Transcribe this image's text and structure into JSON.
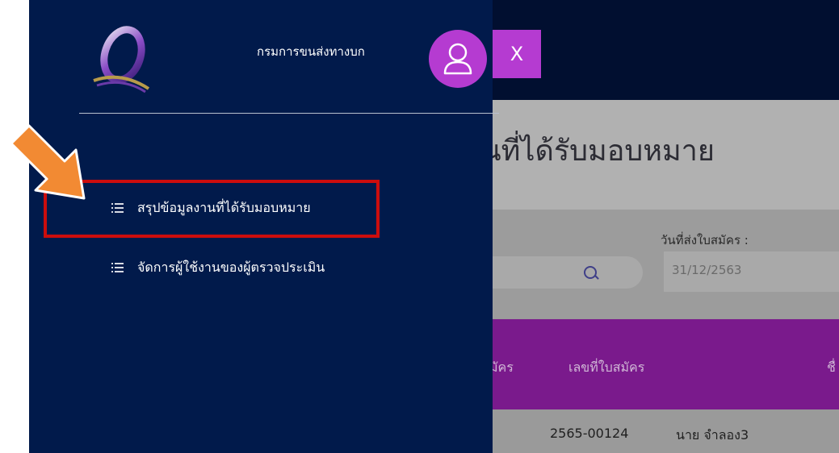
{
  "app": {
    "close_label": "X",
    "page_title": "นที่ได้รับมอบหมาย",
    "date_label": "วันที่ส่งใบสมัคร :",
    "date_value": "31/12/2563",
    "table": {
      "headers": [
        "มัคร",
        "เลขที่ใบสมัคร",
        "ชื่"
      ],
      "row": [
        "2565-00124",
        "นาย จำลอง3"
      ]
    }
  },
  "sidebar": {
    "org_name": "กรมการขนส่งทางบก",
    "menu": [
      {
        "label": "สรุปข้อมูลงานที่ได้รับมอบหมาย",
        "icon": "list-icon"
      },
      {
        "label": "จัดการผู้ใช้งานของผู้ตรวจประเมิน",
        "icon": "list-icon"
      }
    ]
  },
  "colors": {
    "sidebar_bg": "#011a4b",
    "topbar_bg": "#010f30",
    "accent_purple": "#b53bd1",
    "table_header": "#7a1a8c",
    "highlight_red": "#cc0d0d",
    "arrow_orange": "#f28a33"
  }
}
